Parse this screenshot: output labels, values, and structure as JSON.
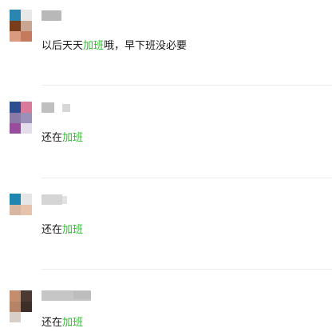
{
  "comments": [
    {
      "avatar_colors": [
        "#2a86b0",
        "#e8e8e8",
        "#7a3d1c",
        "#c8a690",
        "#d99a80",
        "#c47a5c"
      ],
      "name_colors": [
        "#b0b0b0",
        "#ffffff"
      ],
      "text_prefix": "以后天天",
      "text_highlight": "加班",
      "text_suffix": "哦，早下班没必要"
    },
    {
      "avatar_colors": [
        "#2f4c8f",
        "#d97a9a",
        "#8c7aa6",
        "#9a90b8",
        "#9a4c9c",
        "#e4dcea"
      ],
      "name_colors": [
        "#b8b8b8",
        "#bdbdbd"
      ],
      "text_prefix": "还在",
      "text_highlight": "加班",
      "text_suffix": ""
    },
    {
      "avatar_colors": [
        "#1f86b0",
        "#e6e6e6",
        "#d7b7a1",
        "#e6c3aa",
        "#ffffff",
        "#ffffff"
      ],
      "name_colors": [
        "#d0d0d0",
        "#cfcfcf"
      ],
      "text_prefix": "还在",
      "text_highlight": "加班",
      "text_suffix": ""
    },
    {
      "avatar_colors": [
        "#c48d6e",
        "#4a3a32",
        "#b58466",
        "#3d2e28",
        "#d8d0c8",
        "#ffffff"
      ],
      "name_colors": [
        "#c0c0c0",
        "#b8b8b8"
      ],
      "text_prefix": "还在",
      "text_highlight": "加班",
      "text_suffix": ""
    }
  ]
}
